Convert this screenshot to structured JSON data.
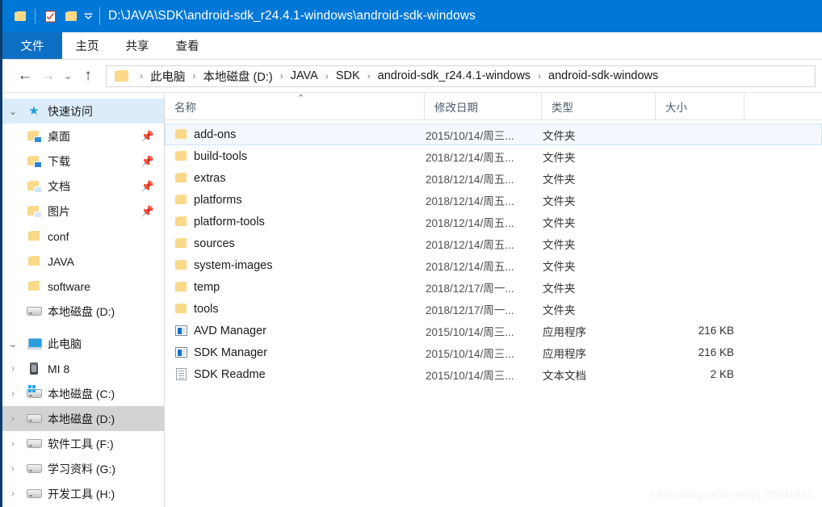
{
  "titlebar": {
    "path": "D:\\JAVA\\SDK\\android-sdk_r24.4.1-windows\\android-sdk-windows",
    "qat": [
      {
        "name": "folder-icon",
        "label": ""
      },
      {
        "name": "properties-icon",
        "label": ""
      },
      {
        "name": "new-folder-icon",
        "label": ""
      },
      {
        "name": "chevron-down-icon",
        "label": "▾"
      }
    ]
  },
  "ribbon": {
    "tabs": [
      {
        "label": "文件",
        "active": true
      },
      {
        "label": "主页",
        "active": false
      },
      {
        "label": "共享",
        "active": false
      },
      {
        "label": "查看",
        "active": false
      }
    ]
  },
  "nav": {
    "back": "←",
    "forward": "→",
    "history": "⌄",
    "up": "↑",
    "separator": "›",
    "breadcrumbs": [
      "此电脑",
      "本地磁盘 (D:)",
      "JAVA",
      "SDK",
      "android-sdk_r24.4.1-windows",
      "android-sdk-windows"
    ]
  },
  "sidebar": {
    "groups": [
      {
        "header": {
          "label": "快速访问",
          "icon": "star-pin-icon",
          "twisty": "⌄",
          "selected": true
        },
        "items": [
          {
            "label": "桌面",
            "icon": "desktop-folder-icon",
            "pinned": true,
            "pin": "📌"
          },
          {
            "label": "下载",
            "icon": "downloads-folder-icon",
            "pinned": true,
            "pin": "📌"
          },
          {
            "label": "文档",
            "icon": "documents-folder-icon",
            "pinned": true,
            "pin": "📌"
          },
          {
            "label": "图片",
            "icon": "pictures-folder-icon",
            "pinned": true,
            "pin": "📌"
          },
          {
            "label": "conf",
            "icon": "folder-icon",
            "pinned": false,
            "pin": ""
          },
          {
            "label": "JAVA",
            "icon": "folder-icon",
            "pinned": false,
            "pin": ""
          },
          {
            "label": "software",
            "icon": "folder-icon",
            "pinned": false,
            "pin": ""
          },
          {
            "label": "本地磁盘 (D:)",
            "icon": "drive-icon",
            "pinned": false,
            "pin": ""
          }
        ]
      },
      {
        "header": {
          "label": "此电脑",
          "icon": "this-pc-icon",
          "twisty": "⌄",
          "selected": false
        },
        "items": [
          {
            "label": "MI 8",
            "icon": "phone-icon",
            "twisty": "›",
            "selected": false
          },
          {
            "label": "本地磁盘 (C:)",
            "icon": "windows-drive-icon",
            "twisty": "›",
            "selected": false
          },
          {
            "label": "本地磁盘 (D:)",
            "icon": "drive-icon",
            "twisty": "›",
            "selected": true
          },
          {
            "label": "软件工具 (F:)",
            "icon": "drive-icon",
            "twisty": "›",
            "selected": false
          },
          {
            "label": "学习资料 (G:)",
            "icon": "drive-icon",
            "twisty": "›",
            "selected": false
          },
          {
            "label": "开发工具 (H:)",
            "icon": "drive-icon",
            "twisty": "›",
            "selected": false
          }
        ]
      }
    ]
  },
  "filelist": {
    "columns": [
      {
        "key": "name",
        "label": "名称",
        "sorted": true,
        "sort_caret": "⌃"
      },
      {
        "key": "date",
        "label": "修改日期"
      },
      {
        "key": "type",
        "label": "类型"
      },
      {
        "key": "size",
        "label": "大小"
      }
    ],
    "rows": [
      {
        "name": "add-ons",
        "date": "2015/10/14/周三...",
        "type": "文件夹",
        "size": "",
        "icon": "folder-icon",
        "focused": true
      },
      {
        "name": "build-tools",
        "date": "2018/12/14/周五...",
        "type": "文件夹",
        "size": "",
        "icon": "folder-icon",
        "focused": false
      },
      {
        "name": "extras",
        "date": "2018/12/14/周五...",
        "type": "文件夹",
        "size": "",
        "icon": "folder-icon",
        "focused": false
      },
      {
        "name": "platforms",
        "date": "2018/12/14/周五...",
        "type": "文件夹",
        "size": "",
        "icon": "folder-icon",
        "focused": false
      },
      {
        "name": "platform-tools",
        "date": "2018/12/14/周五...",
        "type": "文件夹",
        "size": "",
        "icon": "folder-icon",
        "focused": false
      },
      {
        "name": "sources",
        "date": "2018/12/14/周五...",
        "type": "文件夹",
        "size": "",
        "icon": "folder-icon",
        "focused": false
      },
      {
        "name": "system-images",
        "date": "2018/12/14/周五...",
        "type": "文件夹",
        "size": "",
        "icon": "folder-icon",
        "focused": false
      },
      {
        "name": "temp",
        "date": "2018/12/17/周一...",
        "type": "文件夹",
        "size": "",
        "icon": "folder-icon",
        "focused": false
      },
      {
        "name": "tools",
        "date": "2018/12/17/周一...",
        "type": "文件夹",
        "size": "",
        "icon": "folder-icon",
        "focused": false
      },
      {
        "name": "AVD Manager",
        "date": "2015/10/14/周三...",
        "type": "应用程序",
        "size": "216 KB",
        "icon": "exe-icon",
        "focused": false
      },
      {
        "name": "SDK Manager",
        "date": "2015/10/14/周三...",
        "type": "应用程序",
        "size": "216 KB",
        "icon": "exe-icon",
        "focused": false
      },
      {
        "name": "SDK Readme",
        "date": "2015/10/14/周三...",
        "type": "文本文档",
        "size": "2 KB",
        "icon": "txt-icon",
        "focused": false
      }
    ]
  },
  "watermark": {
    "text": "https://blog.csdn.net/qq_38941812"
  },
  "colors": {
    "titlebar": "#0078d7",
    "file_tab": "#0d6fc4",
    "selection_fill": "#f2f8fd",
    "selection_border": "#cfe4f5",
    "quickaccess_header": "#dcecf9",
    "sidebar_selected": "#d3d3d3",
    "window_border": "#0d3c6e"
  }
}
